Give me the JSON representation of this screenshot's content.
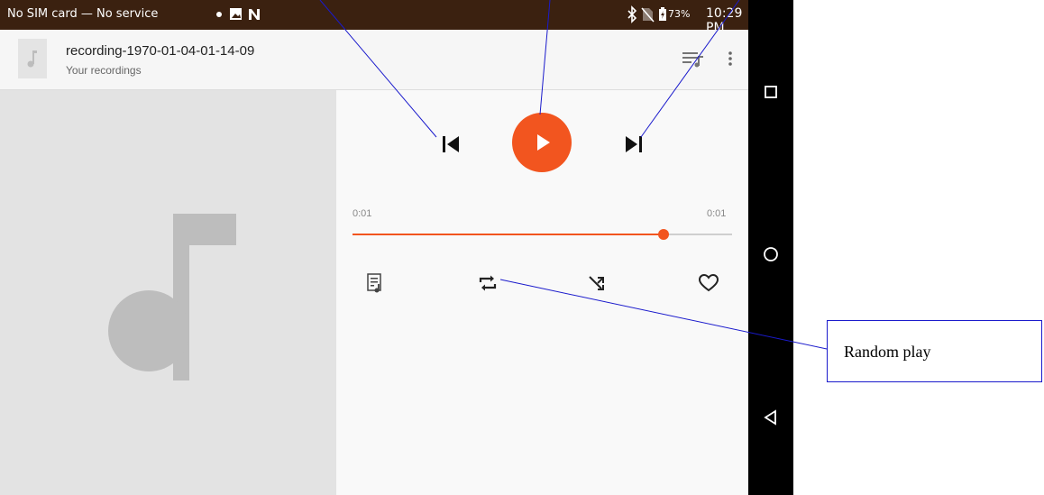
{
  "status_bar": {
    "carrier": "No SIM card — No service",
    "battery_percent": "73%",
    "time": "10:29 PM",
    "icons": [
      "settings-dot-icon",
      "image-icon",
      "notification-n-icon",
      "bluetooth-icon",
      "no-sim-icon",
      "battery-icon"
    ]
  },
  "app_bar": {
    "title": "recording-1970-01-04-01-14-09",
    "subtitle": "Your recordings",
    "icons": [
      "music-note-icon",
      "queue-icon",
      "overflow-menu-icon"
    ]
  },
  "player": {
    "elapsed": "0:01",
    "duration": "0:01",
    "progress": 0.82,
    "accent_color": "#f2551f",
    "controls": [
      "previous-icon",
      "play-icon",
      "next-icon"
    ],
    "actions": [
      "lyrics-icon",
      "repeat-icon",
      "shuffle-icon",
      "favorite-icon"
    ]
  },
  "nav_bar": {
    "icons": [
      "recents-icon",
      "home-icon",
      "back-icon"
    ]
  },
  "annotation": {
    "callout_label": "Random play",
    "line_color": "#1a1acc"
  }
}
